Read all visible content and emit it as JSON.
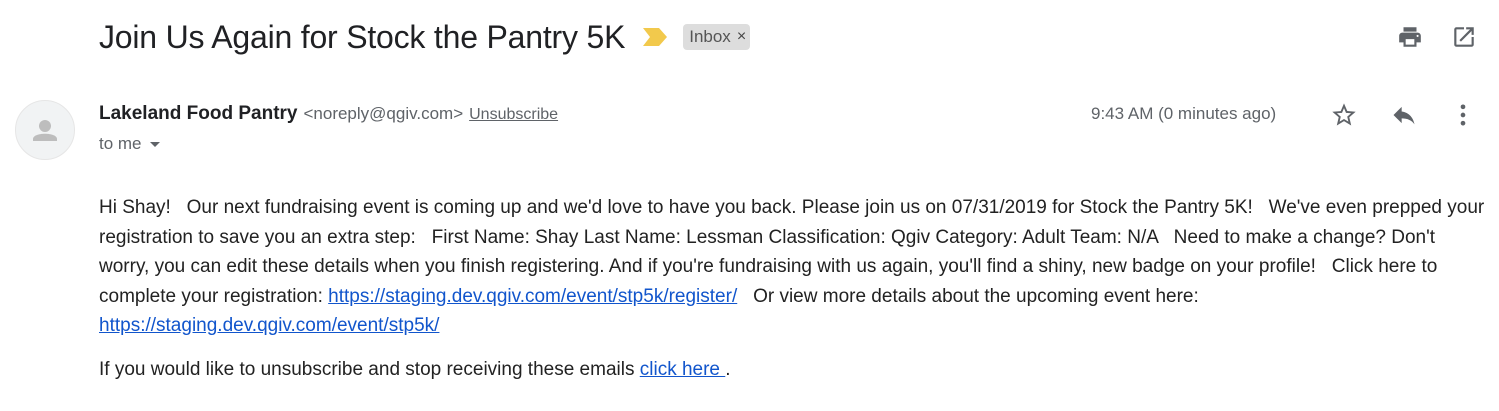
{
  "subject": "Join Us Again for Stock the Pantry 5K",
  "label": {
    "name": "Inbox",
    "remove_glyph": "×"
  },
  "toolbar": {
    "print_icon": "printer-icon",
    "popout_icon": "open-in-new-window-icon"
  },
  "sender": {
    "name": "Lakeland Food Pantry",
    "email": "<noreply@qgiv.com>",
    "unsubscribe_label": "Unsubscribe"
  },
  "recipient": {
    "label": "to me"
  },
  "timestamp": "9:43 AM (0 minutes ago)",
  "actions": {
    "star_icon": "star-outline-icon",
    "reply_icon": "reply-arrow-icon",
    "more_icon": "more-vertical-icon"
  },
  "body": {
    "text_before_link1": "Hi Shay!   Our next fundraising event is coming up and we'd love to have you back. Please join us on 07/31/2019 for Stock the Pantry 5K!   We've even prepped your registration to save you an extra step:   First Name: Shay Last Name: Lessman Classification: Qgiv Category: Adult Team: N/A   Need to make a change? Don't worry, you can edit these details when you finish registering. And if you're fundraising with us again, you'll find a shiny, new badge on your profile!   Click here to complete your registration: ",
    "link1": "https://staging.dev.qgiv.com/event/stp5k/register/",
    "text_between_links": "   Or view more details about the upcoming event here: ",
    "link2": "https://staging.dev.qgiv.com/event/stp5k/"
  },
  "unsubscribe_footer": {
    "text": "If you would like to unsubscribe and stop receiving these emails ",
    "link": "click here ",
    "end": "."
  },
  "colors": {
    "link": "#1155cc",
    "importance_marker": "#f2c94c",
    "label_bg": "#dddddd"
  }
}
